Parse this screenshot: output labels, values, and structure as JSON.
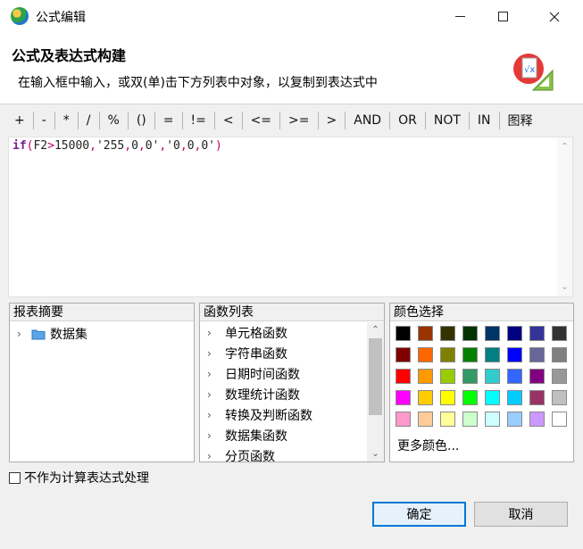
{
  "window": {
    "title": "公式编辑"
  },
  "header": {
    "title": "公式及表达式构建",
    "description": "在输入框中输入，或双(单)击下方列表中对象，以复制到表达式中",
    "icon": "formula-icon"
  },
  "operators": [
    "+",
    "-",
    "*",
    "/",
    "%",
    "()",
    "=",
    "!=",
    "<",
    "<=",
    ">=",
    ">",
    "AND",
    "OR",
    "NOT",
    "IN",
    "图释"
  ],
  "editor": {
    "tokens": [
      {
        "text": "if",
        "type": "kw"
      },
      {
        "text": "(",
        "type": "paren"
      },
      {
        "text": "F2",
        "type": "plain"
      },
      {
        "text": ">",
        "type": "op"
      },
      {
        "text": "15000",
        "type": "plain"
      },
      {
        "text": ",",
        "type": "op"
      },
      {
        "text": "'255",
        "type": "plain"
      },
      {
        "text": ",",
        "type": "op"
      },
      {
        "text": "0",
        "type": "plain"
      },
      {
        "text": ",",
        "type": "op"
      },
      {
        "text": "0'",
        "type": "plain"
      },
      {
        "text": ",",
        "type": "op"
      },
      {
        "text": "'0",
        "type": "plain"
      },
      {
        "text": ",",
        "type": "op"
      },
      {
        "text": "0",
        "type": "plain"
      },
      {
        "text": ",",
        "type": "op"
      },
      {
        "text": "0'",
        "type": "plain"
      },
      {
        "text": ")",
        "type": "paren"
      }
    ]
  },
  "report_panel": {
    "title": "报表摘要",
    "items": [
      {
        "label": "数据集",
        "icon": "folder-icon"
      }
    ]
  },
  "function_panel": {
    "title": "函数列表",
    "items": [
      "单元格函数",
      "字符串函数",
      "日期时间函数",
      "数理统计函数",
      "转换及判断函数",
      "数据集函数",
      "分页函数"
    ]
  },
  "color_panel": {
    "title": "颜色选择",
    "colors": [
      "#000000",
      "#993300",
      "#333300",
      "#003300",
      "#003366",
      "#000080",
      "#333399",
      "#333333",
      "#800000",
      "#ff6600",
      "#808000",
      "#008000",
      "#008080",
      "#0000ff",
      "#666699",
      "#808080",
      "#ff0000",
      "#ff9900",
      "#99cc00",
      "#339966",
      "#33cccc",
      "#3366ff",
      "#800080",
      "#999999",
      "#ff00ff",
      "#ffcc00",
      "#ffff00",
      "#00ff00",
      "#00ffff",
      "#00ccff",
      "#993366",
      "#c0c0c0",
      "#ff99cc",
      "#ffcc99",
      "#ffff99",
      "#ccffcc",
      "#ccffff",
      "#99ccff",
      "#cc99ff",
      "#ffffff"
    ],
    "more_label": "更多颜色..."
  },
  "checkbox": {
    "label": "不作为计算表达式处理",
    "checked": false
  },
  "buttons": {
    "ok": "确定",
    "cancel": "取消"
  }
}
